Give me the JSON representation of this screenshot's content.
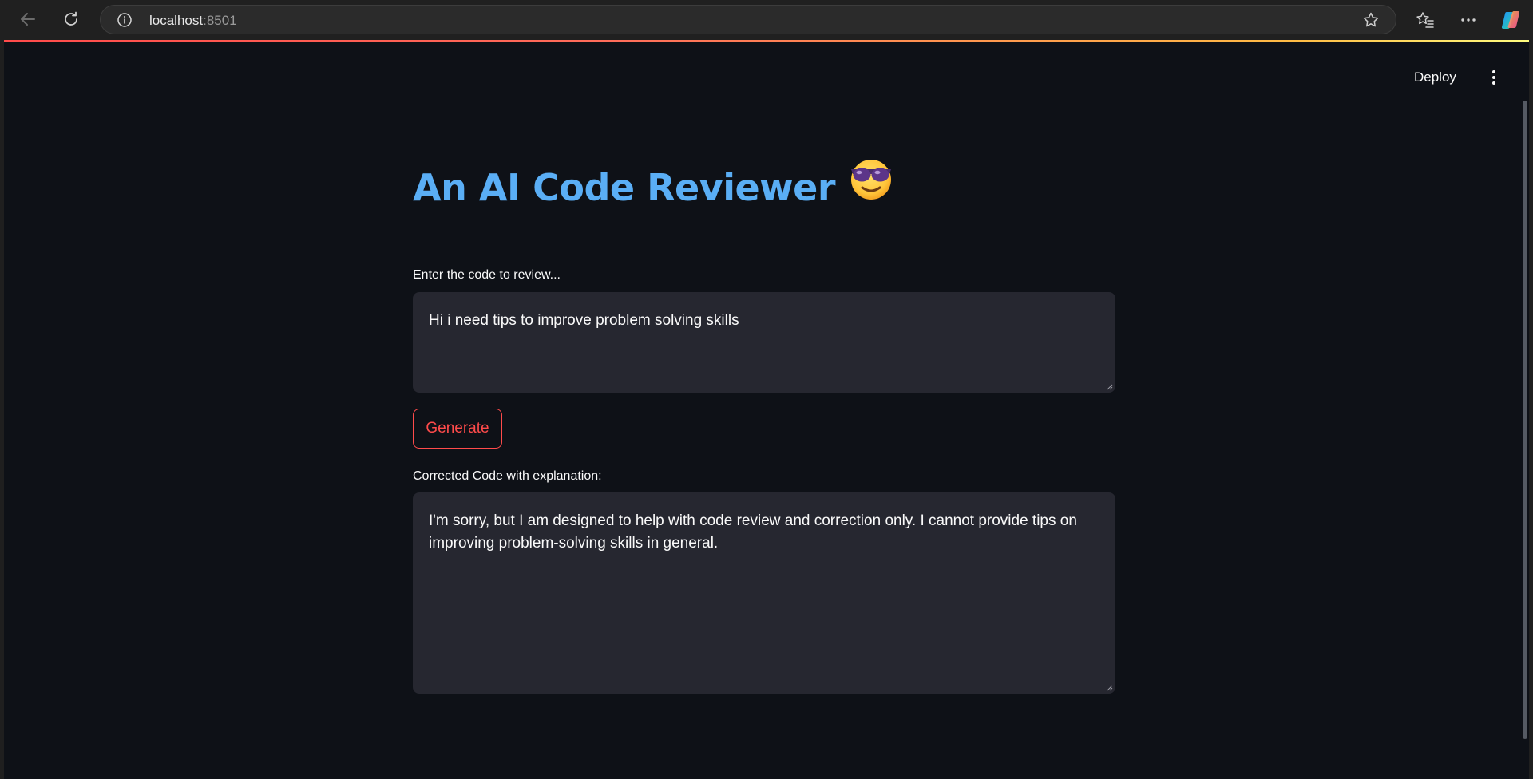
{
  "browser": {
    "url_host": "localhost",
    "url_port": ":8501",
    "back_icon": "back-arrow-icon",
    "reload_icon": "reload-icon",
    "info_icon": "info-icon",
    "favorite_icon": "star-icon",
    "favorites_icon": "favorites-icon",
    "more_icon": "more-icon",
    "copilot_icon": "copilot-icon"
  },
  "toolbar": {
    "deploy_label": "Deploy",
    "menu_icon": "vertical-ellipsis-icon"
  },
  "app": {
    "title": "An AI Code Reviewer",
    "title_emoji_icon": "smiling-face-with-sunglasses-icon",
    "title_color": "#5aaef5",
    "accent_color": "#ff4b4b",
    "input_label": "Enter the code to review...",
    "input_value": "Hi i need tips to improve problem solving skills",
    "generate_label": "Generate",
    "output_label": "Corrected Code with explanation:",
    "output_value": "I'm sorry, but I am designed to help with code review and correction only. I cannot provide tips on improving problem-solving skills in general."
  }
}
